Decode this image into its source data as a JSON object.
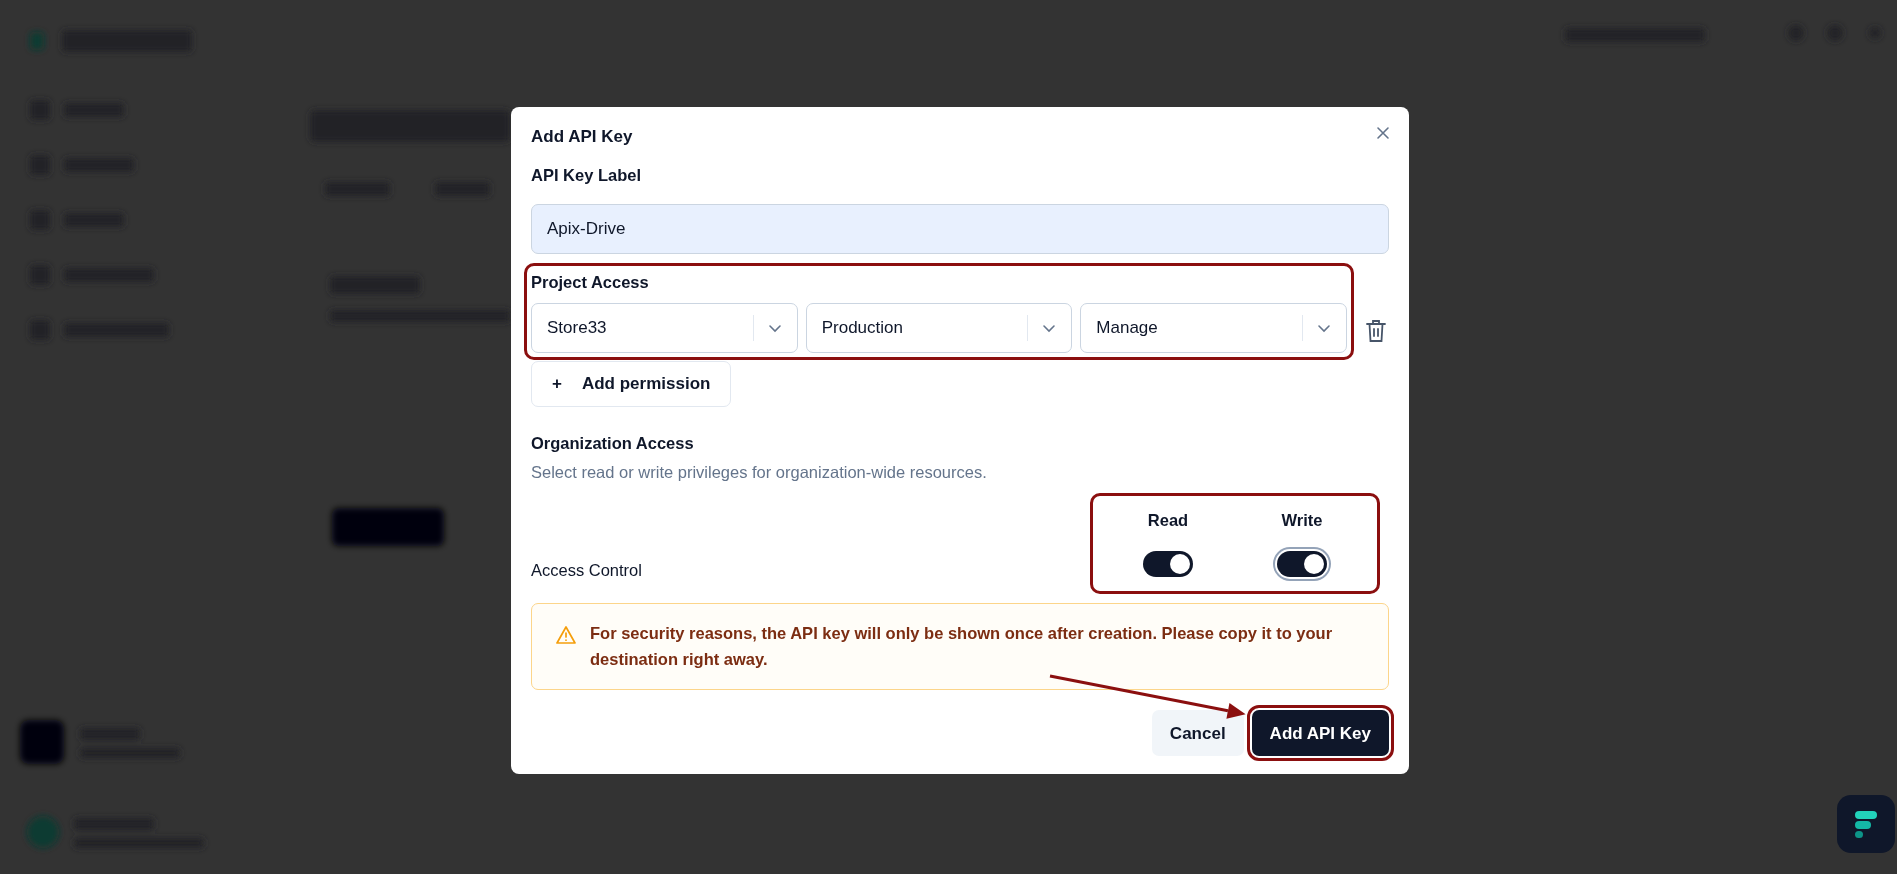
{
  "dialog": {
    "title": "Add API Key",
    "label_field": {
      "label": "API Key Label",
      "value": "Apix-Drive",
      "autofilled": true
    },
    "project_access": {
      "title": "Project Access",
      "highlighted": true,
      "rows": [
        {
          "selects": [
            "Store33",
            "Production",
            "Manage"
          ]
        }
      ],
      "add_button": {
        "icon": "+",
        "label": "Add permission"
      }
    },
    "organization_access": {
      "title": "Organization Access",
      "description": "Select read or write privileges for organization-wide resources.",
      "highlighted": true,
      "columns": [
        "Read",
        "Write"
      ],
      "rows": [
        {
          "label": "Access Control",
          "toggles": [
            {
              "on": true,
              "focused": false
            },
            {
              "on": true,
              "focused": true
            }
          ]
        }
      ]
    },
    "warning": {
      "text": "For security reasons, the API key will only be shown once after creation. Please copy it to your destination right away."
    },
    "buttons": [
      {
        "label": "Cancel",
        "kind": "secondary",
        "highlighted": false
      },
      {
        "label": "Add API Key",
        "kind": "primary",
        "highlighted": true
      }
    ]
  },
  "annotation_arrow": true
}
